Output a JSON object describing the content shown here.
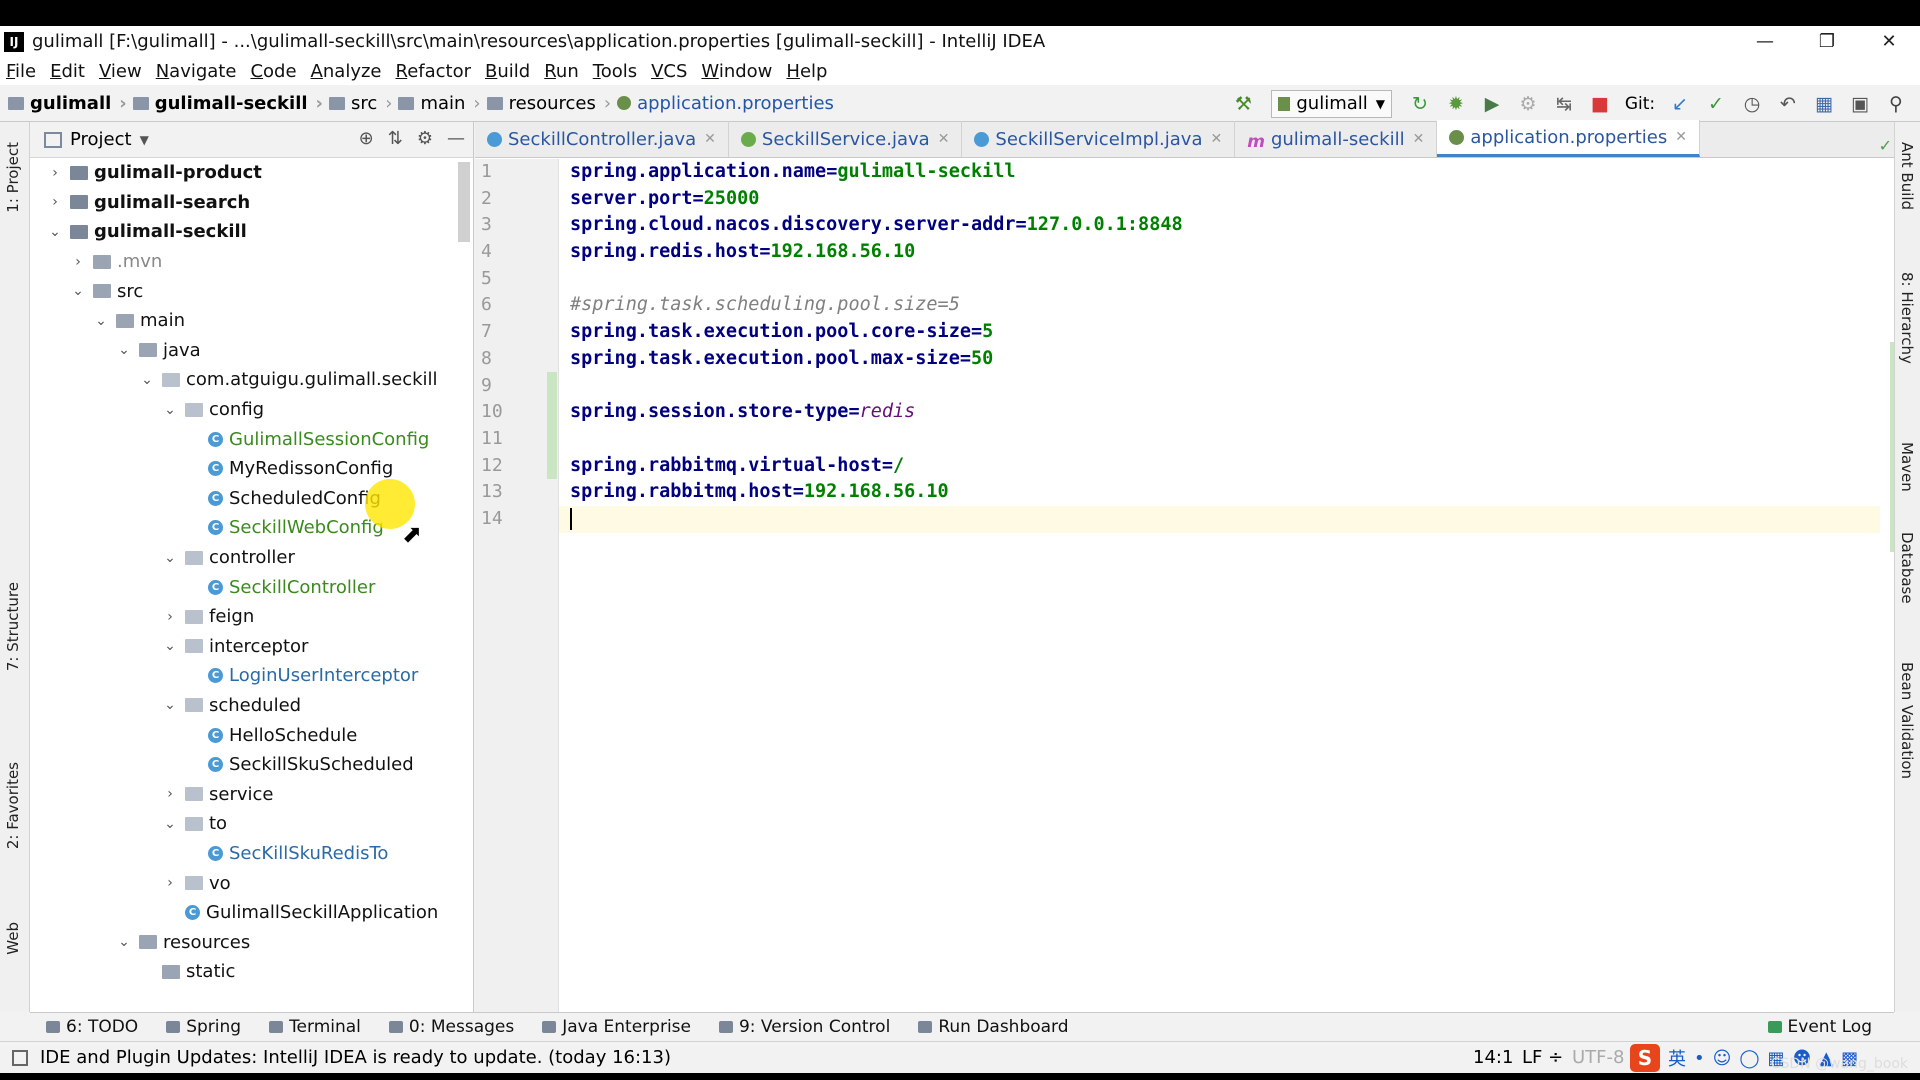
{
  "window": {
    "title": "gulimall [F:\\gulimall] - ...\\gulimall-seckill\\src\\main\\resources\\application.properties [gulimall-seckill] - IntelliJ IDEA",
    "app_icon": "IJ"
  },
  "menu": [
    "File",
    "Edit",
    "View",
    "Navigate",
    "Code",
    "Analyze",
    "Refactor",
    "Build",
    "Run",
    "Tools",
    "VCS",
    "Window",
    "Help"
  ],
  "breadcrumb": [
    "gulimall",
    "gulimall-seckill",
    "src",
    "main",
    "resources",
    "application.properties"
  ],
  "toolbar": {
    "run_config": "gulimall",
    "git_label": "Git:"
  },
  "project_panel": {
    "title": "Project"
  },
  "tree": [
    {
      "label": "gulimall-product",
      "style": "bold",
      "kind": "mod",
      "arrow": "›"
    },
    {
      "label": "gulimall-search",
      "style": "bold",
      "kind": "mod",
      "arrow": "›"
    },
    {
      "label": "gulimall-seckill",
      "style": "bold",
      "kind": "mod",
      "arrow": "⌄"
    },
    {
      "label": ".mvn",
      "style": "mvn",
      "kind": "folder",
      "arrow": "›"
    },
    {
      "label": "src",
      "style": "",
      "kind": "folder",
      "arrow": "⌄"
    },
    {
      "label": "main",
      "style": "",
      "kind": "folder",
      "arrow": "⌄"
    },
    {
      "label": "java",
      "style": "",
      "kind": "folder",
      "arrow": "⌄"
    },
    {
      "label": "com.atguigu.gulimall.seckill",
      "style": "",
      "kind": "pkg",
      "arrow": "⌄"
    },
    {
      "label": "config",
      "style": "",
      "kind": "pkg",
      "arrow": "⌄"
    },
    {
      "label": "GulimallSessionConfig",
      "style": "green",
      "kind": "class",
      "arrow": ""
    },
    {
      "label": "MyRedissonConfig",
      "style": "",
      "kind": "class",
      "arrow": ""
    },
    {
      "label": "ScheduledConfig",
      "style": "",
      "kind": "class",
      "arrow": ""
    },
    {
      "label": "SeckillWebConfig",
      "style": "green",
      "kind": "class",
      "arrow": ""
    },
    {
      "label": "controller",
      "style": "",
      "kind": "pkg",
      "arrow": "⌄"
    },
    {
      "label": "SeckillController",
      "style": "green",
      "kind": "class",
      "arrow": ""
    },
    {
      "label": "feign",
      "style": "",
      "kind": "pkg",
      "arrow": "›"
    },
    {
      "label": "interceptor",
      "style": "",
      "kind": "pkg",
      "arrow": "⌄"
    },
    {
      "label": "LoginUserInterceptor",
      "style": "blue",
      "kind": "class",
      "arrow": ""
    },
    {
      "label": "scheduled",
      "style": "",
      "kind": "pkg",
      "arrow": "⌄"
    },
    {
      "label": "HelloSchedule",
      "style": "",
      "kind": "class",
      "arrow": ""
    },
    {
      "label": "SeckillSkuScheduled",
      "style": "",
      "kind": "class",
      "arrow": ""
    },
    {
      "label": "service",
      "style": "",
      "kind": "pkg",
      "arrow": "›"
    },
    {
      "label": "to",
      "style": "",
      "kind": "pkg",
      "arrow": "⌄"
    },
    {
      "label": "SecKillSkuRedisTo",
      "style": "blue",
      "kind": "class",
      "arrow": ""
    },
    {
      "label": "vo",
      "style": "",
      "kind": "pkg",
      "arrow": "›"
    },
    {
      "label": "GulimallSeckillApplication",
      "style": "",
      "kind": "class",
      "arrow": ""
    },
    {
      "label": "resources",
      "style": "",
      "kind": "folder",
      "arrow": "⌄"
    },
    {
      "label": "static",
      "style": "",
      "kind": "folder",
      "arrow": ""
    }
  ],
  "tabs": [
    {
      "label": "SeckillController.java",
      "icon": "class"
    },
    {
      "label": "SeckillService.java",
      "icon": "iface"
    },
    {
      "label": "SeckillServiceImpl.java",
      "icon": "class"
    },
    {
      "label": "gulimall-seckill",
      "icon": "mvn"
    },
    {
      "label": "application.properties",
      "icon": "prop",
      "active": true
    }
  ],
  "code_lines": [
    {
      "n": "1",
      "k": "spring.application.name",
      "v": "gulimall-seckill"
    },
    {
      "n": "2",
      "k": "server.port",
      "v": "25000"
    },
    {
      "n": "3",
      "k": "spring.cloud.nacos.discovery.server-addr",
      "v": "127.0.0.1:8848"
    },
    {
      "n": "4",
      "k": "spring.redis.host",
      "v": "192.168.56.10"
    },
    {
      "n": "5"
    },
    {
      "n": "6",
      "comment": "#spring.task.scheduling.pool.size=5"
    },
    {
      "n": "7",
      "k": "spring.task.execution.pool.core-size",
      "v": "5"
    },
    {
      "n": "8",
      "k": "spring.task.execution.pool.max-size",
      "v": "50"
    },
    {
      "n": "9"
    },
    {
      "n": "10",
      "k": "spring.session.store-type",
      "vi": "redis"
    },
    {
      "n": "11"
    },
    {
      "n": "12",
      "k": "spring.rabbitmq.virtual-host",
      "v": "/"
    },
    {
      "n": "13",
      "k": "spring.rabbitmq.host",
      "v": "192.168.56.10"
    },
    {
      "n": "14",
      "current": true
    }
  ],
  "left_strip": [
    "1: Project",
    "7: Structure",
    "2: Favorites",
    "Web"
  ],
  "right_strip": [
    "Ant Build",
    "8: Hierarchy",
    "Maven",
    "Database",
    "Bean Validation"
  ],
  "bottom_tabs": [
    "6: TODO",
    "Spring",
    "Terminal",
    "0: Messages",
    "Java Enterprise",
    "9: Version Control",
    "Run Dashboard"
  ],
  "event_log": "Event Log",
  "status": {
    "message": "IDE and Plugin Updates: IntelliJ IDEA is ready to update. (today 16:13)",
    "position": "14:1",
    "line_sep": "LF ÷",
    "encoding": "UTF-8",
    "ime": "英"
  },
  "watermark": "CSDN @wang_book"
}
